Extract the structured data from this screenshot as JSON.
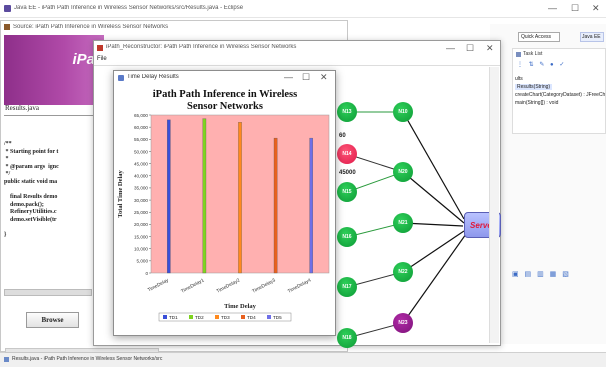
{
  "eclipse": {
    "title": "Java EE - iPath Path Inference in Wireless Sensor Networks/src/Results.java - Eclipse",
    "quick_access": "Quick Access",
    "perspective": "Java EE",
    "outline_title": "Task List",
    "outline_items": [
      "ults",
      "Results(String)",
      "createChart(CategoryDataset) : JFreeCh",
      "main(String[]) : void"
    ],
    "status_text": "Results.java - iPath Path Inference in Wireless Sensor Networks/src"
  },
  "source_window": {
    "title": "Source: iPath Path Inference in Wireless Sensor Networks",
    "banner_text": "iPat",
    "file_label": "Results.java",
    "code_lines": [
      "/**",
      " * Starting point for t",
      " *",
      " * @param args  ignc",
      " */",
      "public static void ma",
      "",
      "    final Results demo",
      "    demo.pack();",
      "    RefineryUtilities.c",
      "    demo.setVisible(tr",
      "",
      "}"
    ],
    "browse_label": "Browse"
  },
  "recon_window": {
    "title": "iPath_Reconstructor: iPath Path Inference in Wireless Sensor Networks",
    "menu_file": "File",
    "info_values": [
      "60",
      "45000"
    ],
    "server_label": "Server",
    "nodes": [
      "N13",
      "N10",
      "N14",
      "N15",
      "N20",
      "N16",
      "N21",
      "N22",
      "N17",
      "N23",
      "N18"
    ]
  },
  "chart_window": {
    "title": "Time Delay Results",
    "controls": {
      "min": "—",
      "max": "☐",
      "close": "✕"
    }
  },
  "chart_data": {
    "type": "bar",
    "title": "iPath Path Inference in Wireless Sensor Networks",
    "xlabel": "Time Delay",
    "ylabel": "Total Time Delay",
    "ylim": [
      0,
      65000
    ],
    "yticks": [
      0,
      5000,
      10000,
      15000,
      20000,
      25000,
      30000,
      35000,
      40000,
      45000,
      50000,
      55000,
      60000,
      65000
    ],
    "ytick_labels": [
      "0",
      "5,000",
      "10,000",
      "15,000",
      "20,000",
      "25,000",
      "30,000",
      "35,000",
      "40,000",
      "45,000",
      "50,000",
      "55,000",
      "60,000",
      "65,000"
    ],
    "categories": [
      "TimeDelay",
      "TimeDelay1",
      "TimeDelay2",
      "TimeDelay3",
      "TimeDelay4"
    ],
    "series": [
      {
        "name": "TD1",
        "color": "#3a4fd8",
        "values": [
          63000,
          0,
          0,
          0,
          0
        ]
      },
      {
        "name": "TD2",
        "color": "#7ed31f",
        "values": [
          0,
          63500,
          0,
          0,
          0
        ]
      },
      {
        "name": "TD3",
        "color": "#ff8a1e",
        "values": [
          0,
          0,
          62000,
          0,
          0
        ]
      },
      {
        "name": "TD4",
        "color": "#e8601e",
        "values": [
          0,
          0,
          0,
          55500,
          0
        ]
      },
      {
        "name": "TD5",
        "color": "#6f6fe8",
        "values": [
          0,
          0,
          0,
          0,
          55500
        ]
      }
    ],
    "legend": [
      "TD1",
      "TD2",
      "TD3",
      "TD4",
      "TD5"
    ],
    "legend_colors": [
      "#3a4fd8",
      "#7ed31f",
      "#ff8a1e",
      "#e8601e",
      "#6f6fe8"
    ],
    "plot_background": "#ffb0b0",
    "grid": false,
    "legend_placement": "bottom"
  }
}
